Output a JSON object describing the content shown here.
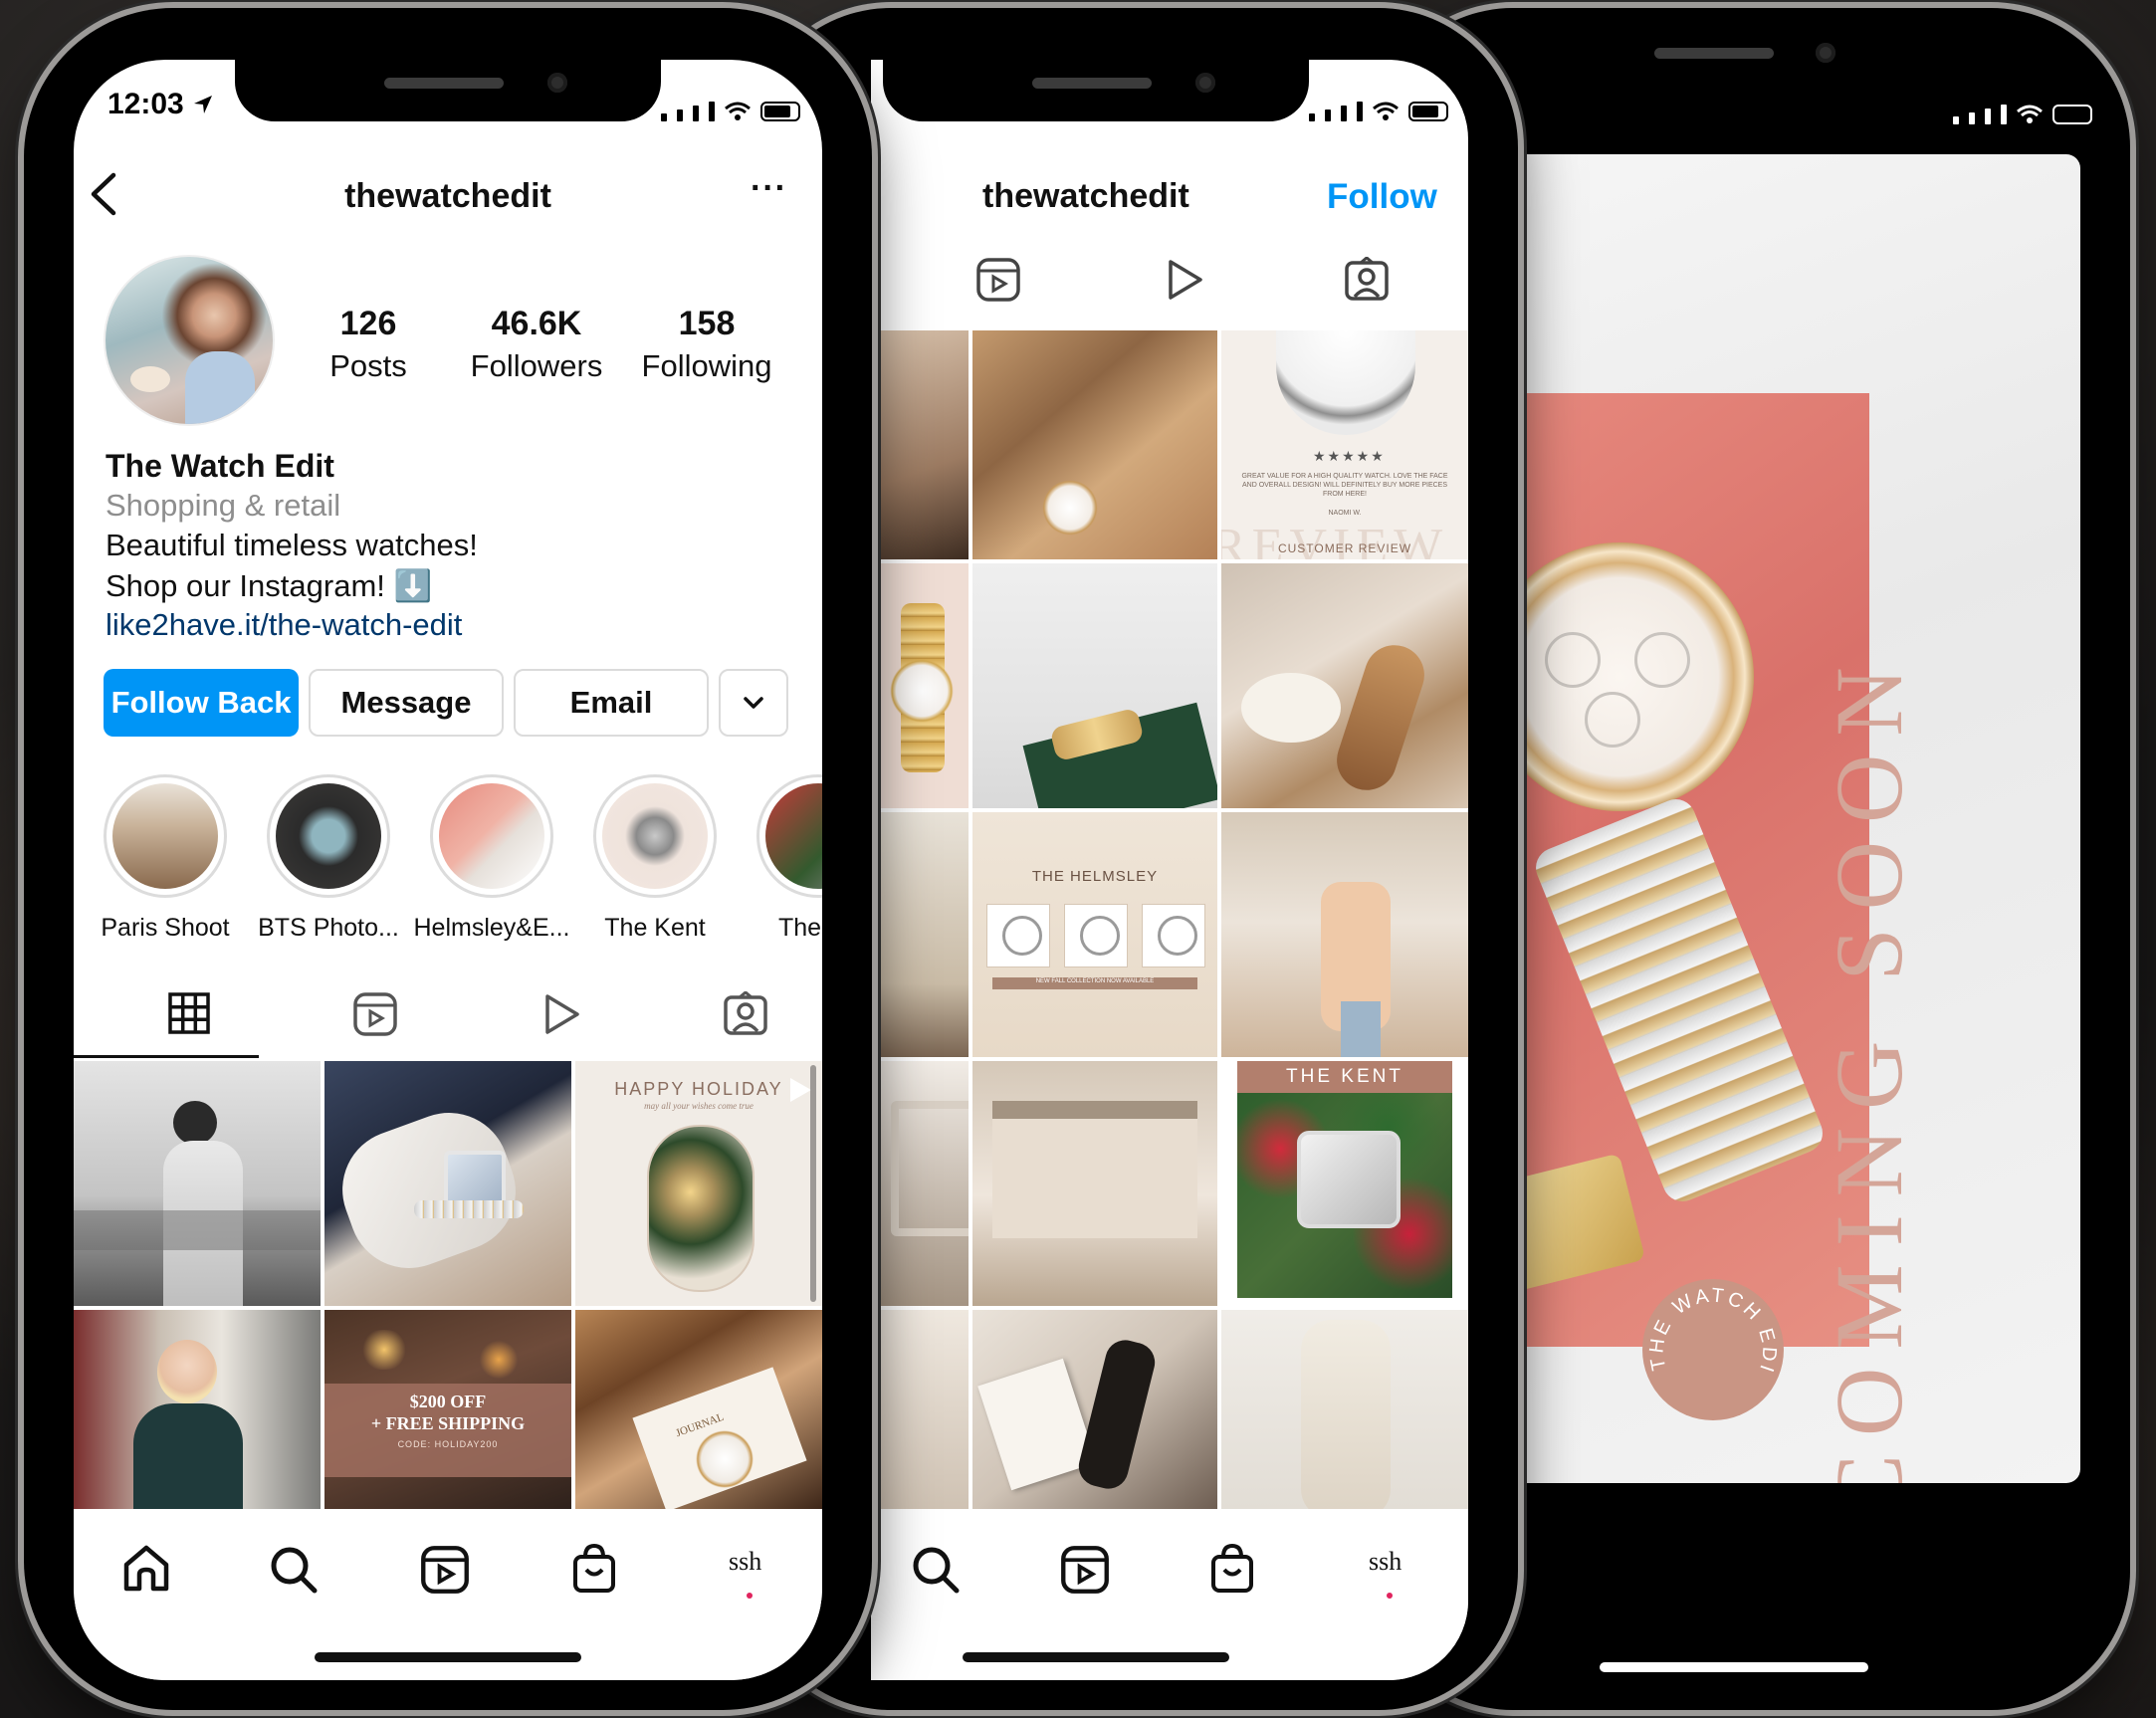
{
  "phone1": {
    "status_time": "12:03",
    "username": "thewatchedit",
    "stats": [
      {
        "value": "126",
        "label": "Posts"
      },
      {
        "value": "46.6K",
        "label": "Followers"
      },
      {
        "value": "158",
        "label": "Following"
      }
    ],
    "display_name": "The Watch Edit",
    "category": "Shopping & retail",
    "bio_line1": "Beautiful timeless watches!",
    "bio_line2": "Shop our Instagram! ⬇️",
    "link": "like2have.it/the-watch-edit",
    "buttons": {
      "follow_back": "Follow Back",
      "message": "Message",
      "email": "Email"
    },
    "highlights": [
      "Paris Shoot",
      "BTS Photo...",
      "Helmsley&E...",
      "The Kent",
      "The E"
    ],
    "posts": {
      "holiday_title": "HAPPY HOLIDAY",
      "holiday_sub": "may all your wishes come true",
      "promo_line1": "$200 OFF",
      "promo_line2": "+ FREE SHIPPING",
      "promo_code": "CODE: HOLIDAY200",
      "journal": "JOURNAL"
    },
    "profile_tab_label": "ssh"
  },
  "phone2": {
    "username": "thewatchedit",
    "follow": "Follow",
    "posts": {
      "review_caption": "GREAT VALUE FOR A HIGH QUALITY WATCH. LOVE THE FACE AND OVERALL DESIGN! WILL DEFINITELY BUY MORE PIECES FROM HERE!",
      "review_name": "NAOMI W.",
      "review_label": "CUSTOMER REVIEW",
      "review_big": "REVIEW",
      "helmsley": "THE HELMSLEY",
      "helmsley_sub": "NEW FALL COLLECTION NOW AVAILABLE",
      "kent": "THE KENT"
    },
    "profile_tab_label": "ssh"
  },
  "phone3": {
    "coming_soon": "COMING SOON",
    "badge": "THE WATCH EDIT"
  },
  "colors": {
    "ig_blue": "#0095f6",
    "link": "#00376b",
    "blush": "#c99584",
    "notif": "#e0245e"
  }
}
